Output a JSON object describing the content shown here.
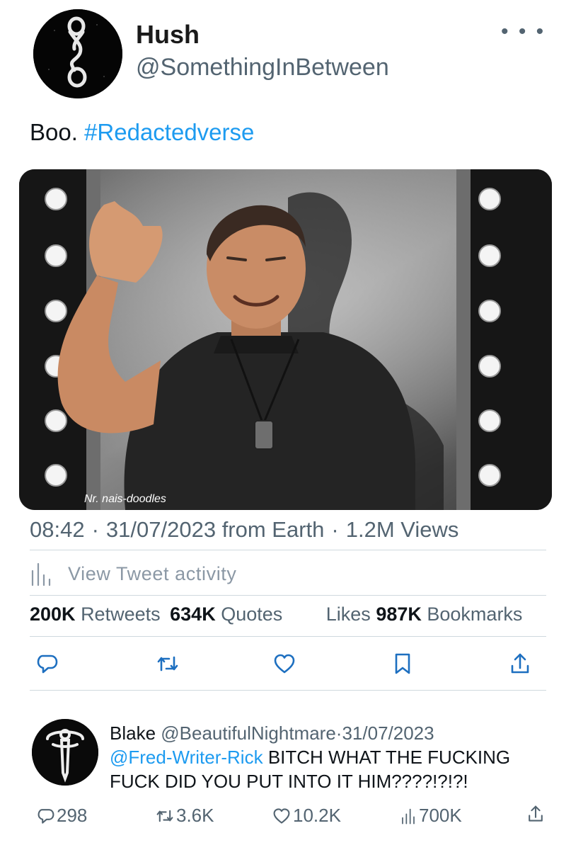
{
  "author": {
    "name": "Hush",
    "handle": "@SomethingInBetween"
  },
  "tweet": {
    "text": "Boo.",
    "hashtag": "#Redactedverse",
    "media": {
      "watermark": "Nr. nais-doodles"
    },
    "time": "08:42",
    "date": "31/07/2023",
    "source": "from Earth",
    "views": "1.2M Views"
  },
  "activity_label": "View Tweet activity",
  "stats": {
    "retweets_count": "200K",
    "retweets_label": "Retweets",
    "quotes_count": "634K",
    "quotes_label": "Quotes",
    "likes_label": "Likes",
    "bookmarks_count": "987K",
    "bookmarks_label": "Bookmarks"
  },
  "actions": {
    "icons": [
      "reply-icon",
      "retweet-icon",
      "like-icon",
      "bookmark-icon",
      "share-icon"
    ]
  },
  "reply": {
    "name": "Blake",
    "handle": "@BeautifulNightmare",
    "separator": "·",
    "date": "31/07/2023",
    "mention": "@Fred-Writer-Rick",
    "text": "BITCH WHAT THE FUCKING FUCK DID YOU PUT INTO IT HIM????!?!?!",
    "replies": "298",
    "retweets": "3.6K",
    "likes": "10.2K",
    "views": "700K"
  },
  "colors": {
    "accent": "#1d9bf0",
    "secondary_text": "#536471",
    "divider": "#cfd9de"
  }
}
